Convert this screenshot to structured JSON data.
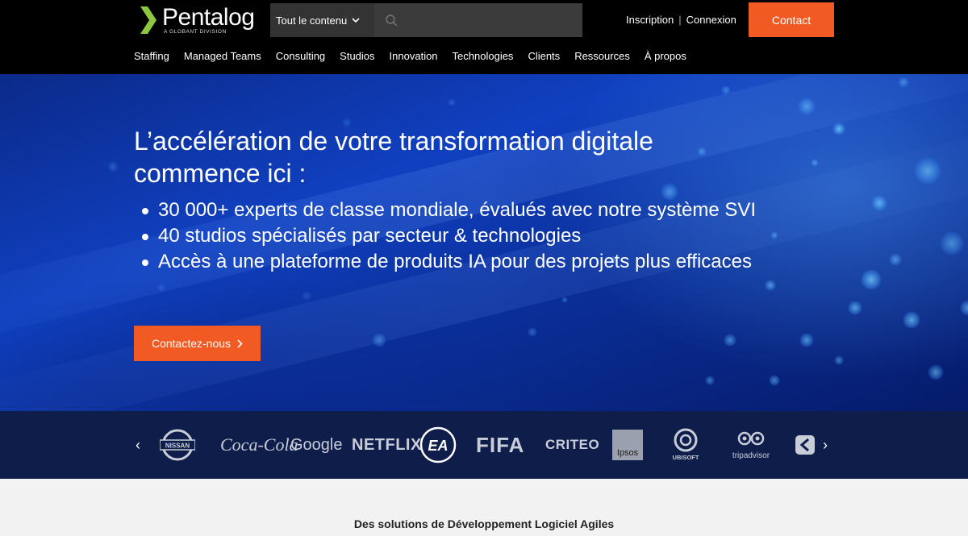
{
  "header": {
    "brand": "Pentalog",
    "brand_sub": "A GLOBANT DIVISION",
    "search_scope": "Tout le contenu",
    "search_placeholder": "",
    "inscription": "Inscription",
    "separator": "|",
    "connexion": "Connexion",
    "contact": "Contact"
  },
  "nav": {
    "items": [
      "Staffing",
      "Managed Teams",
      "Consulting",
      "Studios",
      "Innovation",
      "Technologies",
      "Clients",
      "Ressources",
      "À propos"
    ]
  },
  "hero": {
    "title_line1": "L’accélération de votre transformation digitale",
    "title_line2": "commence ici :",
    "bullets": [
      "30 000+ experts de classe mondiale, évalués avec notre système SVI",
      "40 studios spécialisés par secteur & technologies",
      "Accès à une plateforme de produits IA pour des projets plus efficaces"
    ],
    "cta": "Contactez-nous"
  },
  "clients": {
    "prev": "‹",
    "next": "›",
    "logos": [
      "NISSAN",
      "Coca-Cola",
      "Google",
      "NETFLIX",
      "EA",
      "FIFA",
      "CRITEO",
      "Ipsos",
      "UBISOFT",
      "tripadvisor"
    ]
  },
  "section": {
    "title": "Des solutions de Développement Logiciel Agiles"
  },
  "colors": {
    "accent": "#f15a22",
    "logo_green": "#8dc63f",
    "hero_blue": "#1040c0"
  }
}
